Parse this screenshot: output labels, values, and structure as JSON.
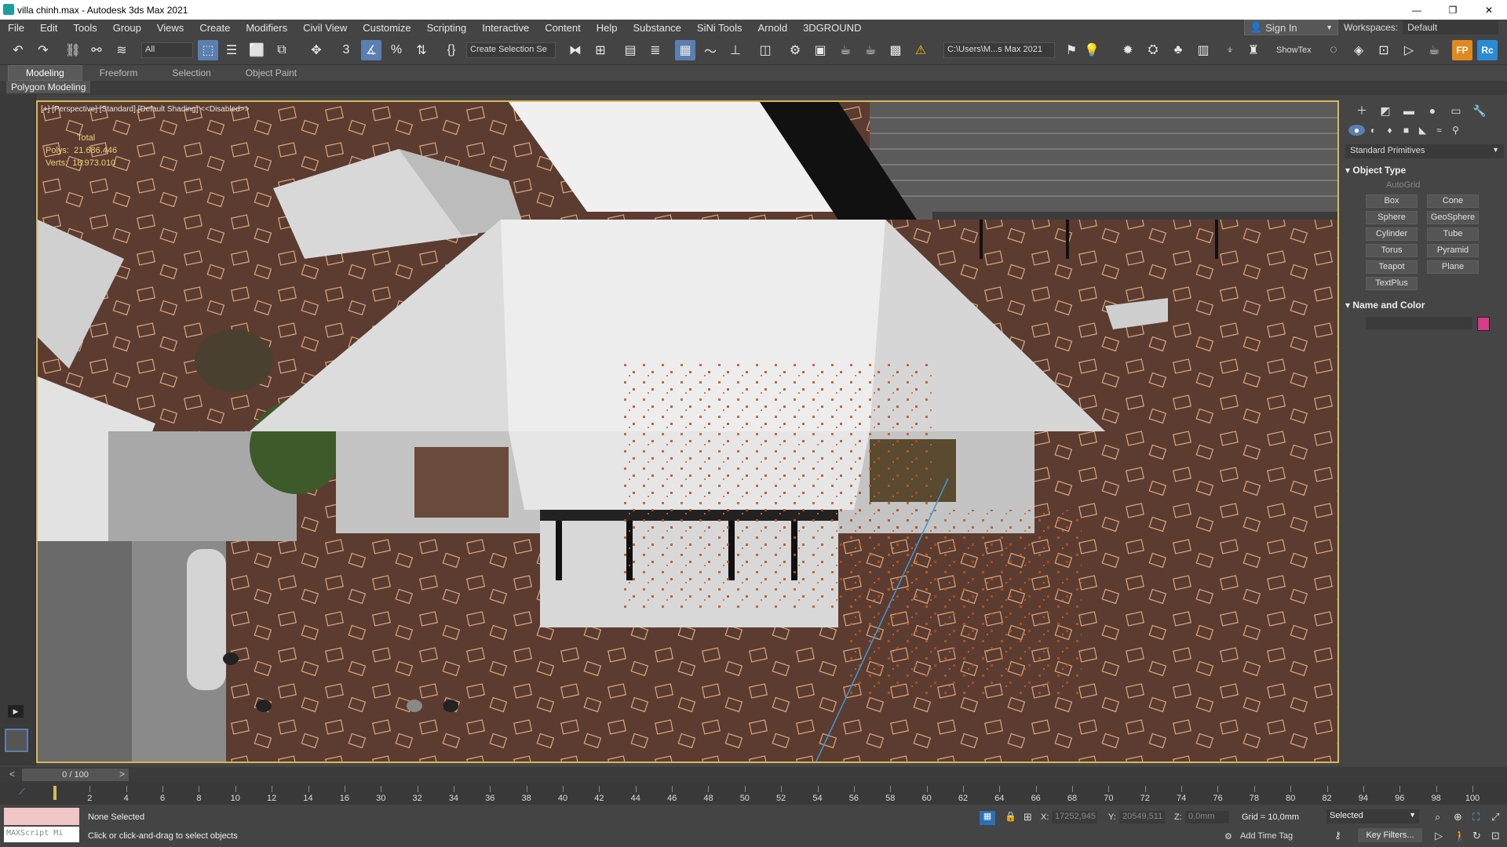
{
  "window": {
    "title": "villa chinh.max - Autodesk 3ds Max 2021",
    "minimize": "—",
    "maximize": "❐",
    "close": "✕"
  },
  "menu": [
    "File",
    "Edit",
    "Tools",
    "Group",
    "Views",
    "Create",
    "Modifiers",
    "Civil View",
    "Customize",
    "Scripting",
    "Interactive",
    "Content",
    "Help",
    "Substance",
    "SiNi Tools",
    "Arnold",
    "3DGROUND"
  ],
  "signin": "Sign In",
  "workspace": {
    "label": "Workspaces:",
    "value": "Default"
  },
  "toolbar": {
    "filter": "All",
    "selection_set": "Create Selection Se",
    "path": "C:\\Users\\M...s Max 2021",
    "showtex": "ShowTex"
  },
  "ribbon": {
    "tabs": [
      "Modeling",
      "Freeform",
      "Selection",
      "Object Paint"
    ],
    "active_tab": "Modeling",
    "panel": "Polygon Modeling"
  },
  "viewport": {
    "label": "[+] [Perspective] [Standard] [Default Shading] <<Disabled>>",
    "stats_total": "Total",
    "polys_label": "Polys:",
    "polys_value": "21.686.446",
    "verts_label": "Verts:",
    "verts_value": "18.973.010"
  },
  "command_panel": {
    "category": "Standard Primitives",
    "object_type_title": "Object Type",
    "autogrid": "AutoGrid",
    "primitives": [
      "Box",
      "Cone",
      "Sphere",
      "GeoSphere",
      "Cylinder",
      "Tube",
      "Torus",
      "Pyramid",
      "Teapot",
      "Plane",
      "TextPlus"
    ],
    "name_color_title": "Name and Color",
    "object_color": "#d83b87"
  },
  "timeline": {
    "frame": "0 / 100",
    "ticks": [
      0,
      2,
      4,
      6,
      8,
      10,
      12,
      14,
      16,
      30,
      32,
      34,
      36,
      38,
      40,
      42,
      44,
      46,
      48,
      50,
      52,
      54,
      56,
      58,
      60,
      62,
      64,
      66,
      68,
      70,
      72,
      74,
      76,
      78,
      80,
      82,
      94,
      96,
      98,
      100
    ]
  },
  "status": {
    "selection": "None Selected",
    "prompt": "Click or click-and-drag to select objects",
    "maxscript": "MAXScript Mi",
    "x_label": "X:",
    "x_value": "17252,945",
    "y_label": "Y:",
    "y_value": "20549,511",
    "z_label": "Z:",
    "z_value": "0,0mm",
    "grid": "Grid = 10,0mm",
    "selected_filter": "Selected",
    "add_time_tag": "Add Time Tag",
    "key_filters": "Key Filters..."
  }
}
